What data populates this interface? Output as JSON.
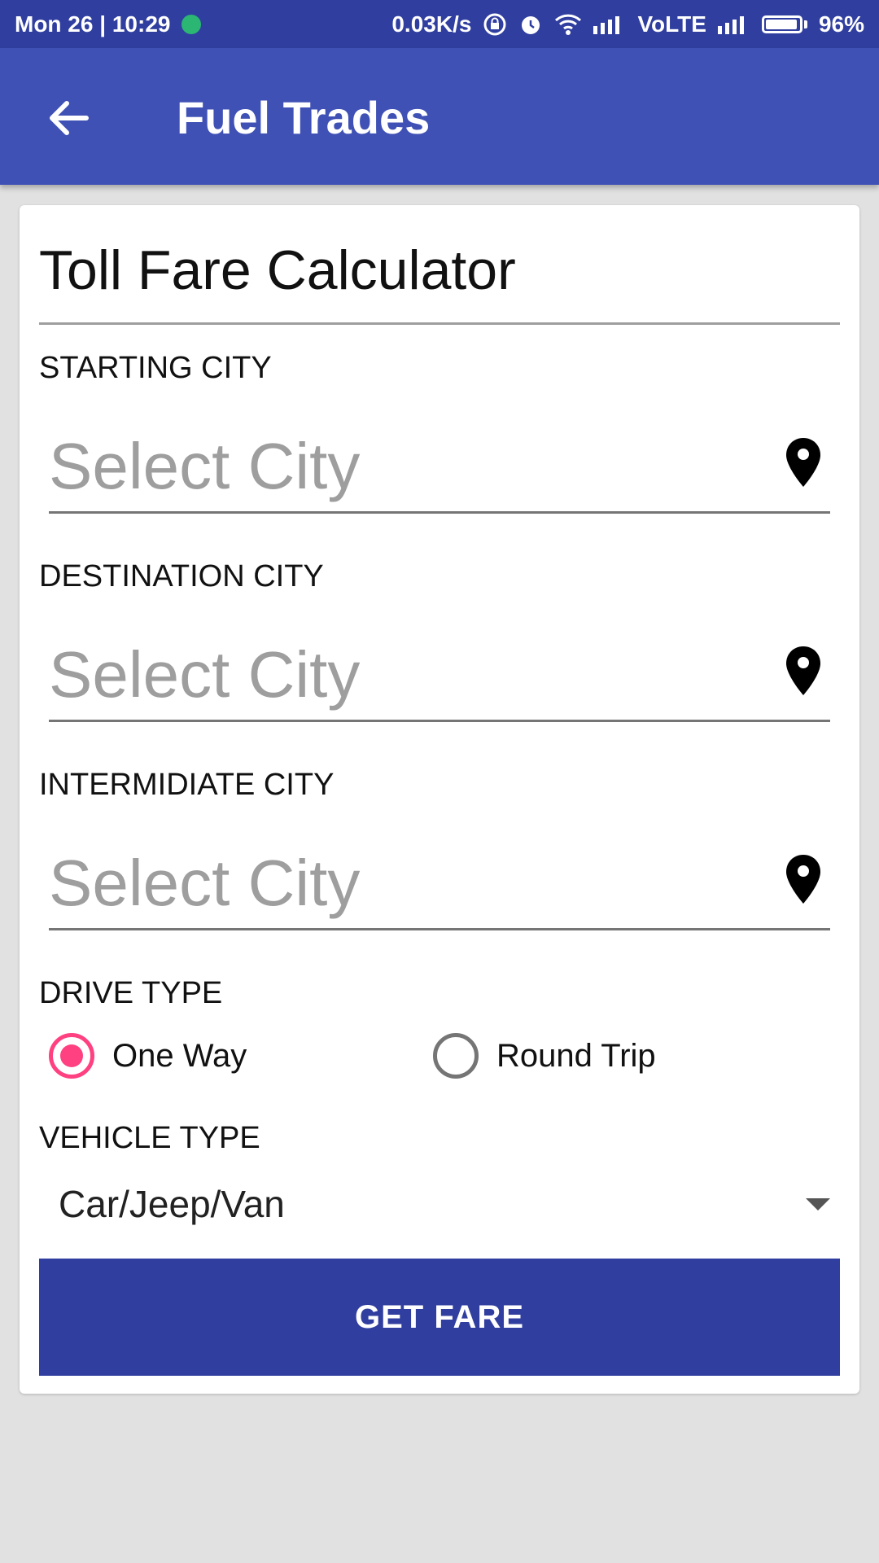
{
  "status_bar": {
    "time": "Mon 26 | 10:29",
    "net_speed": "0.03K/s",
    "network": "VoLTE",
    "battery": "96%",
    "battery_level": 0.96,
    "icons": [
      "notification-icon",
      "lock-rotation-icon",
      "alarm-icon",
      "wifi-icon",
      "signal-icon",
      "signal-icon",
      "battery-icon"
    ]
  },
  "app_bar": {
    "title": "Fuel Trades",
    "back_icon": "arrow-back-icon",
    "color": "#3f51b5"
  },
  "form": {
    "title": "Toll Fare Calculator",
    "starting": {
      "label": "STARTING CITY",
      "placeholder": "Select City",
      "value": "",
      "icon": "location-pin-icon"
    },
    "destination": {
      "label": "DESTINATION CITY",
      "placeholder": "Select City",
      "value": "",
      "icon": "location-pin-icon"
    },
    "intermediate": {
      "label": "INTERMIDIATE CITY",
      "placeholder": "Select City",
      "value": "",
      "icon": "location-pin-icon"
    },
    "drive_type": {
      "label": "DRIVE TYPE",
      "options": [
        {
          "label": "One Way",
          "selected": true
        },
        {
          "label": "Round Trip",
          "selected": false
        }
      ]
    },
    "vehicle_type": {
      "label": "VEHICLE TYPE",
      "selected": "Car/Jeep/Van"
    },
    "submit_label": "GET FARE"
  },
  "colors": {
    "primary": "#3f51b5",
    "primary_dark": "#303f9f",
    "accent": "#ff4081",
    "background": "#e1e1e1"
  }
}
